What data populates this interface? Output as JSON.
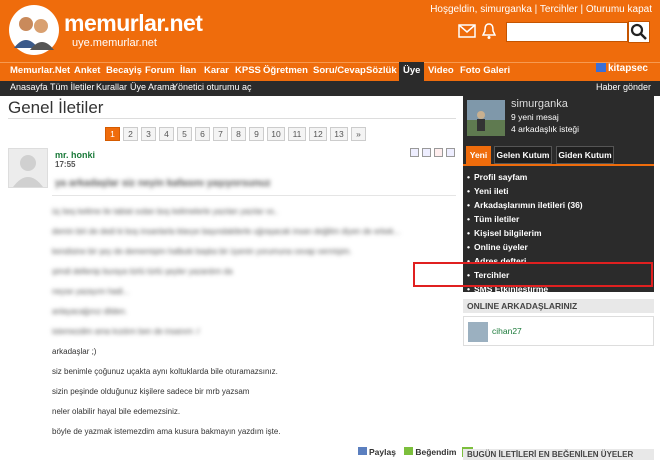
{
  "header": {
    "logo_text": "memurlar.net",
    "logo_sub": "uye.memurlar.net",
    "welcome": "Hoşgeldin, simurganka",
    "preferences_link": "Tercihler",
    "logout_link": "Oturumu kapat",
    "search_placeholder": ""
  },
  "nav": {
    "items": [
      "Memurlar.Net",
      "Anket",
      "Becayiş",
      "Forum",
      "İlan",
      "Karar",
      "KPSS",
      "Öğretmen",
      "Soru/Cevap",
      "Sözlük",
      "Üye",
      "Video",
      "Foto Galeri"
    ],
    "active": "Üye",
    "kitapsec": "kitapsec"
  },
  "subnav": {
    "items": [
      "Anasayfa",
      "Tüm İletiler",
      "Kurallar",
      "Üye Arama",
      "Yönetici oturumu aç"
    ],
    "send_news": "Haber gönder"
  },
  "page": {
    "title": "Genel İletiler",
    "pages": [
      "1",
      "2",
      "3",
      "4",
      "5",
      "6",
      "7",
      "8",
      "9",
      "10",
      "11",
      "12",
      "13",
      "»"
    ],
    "current_page": "1"
  },
  "post": {
    "author": "mr. honki",
    "time": "17:55",
    "headline": "ya arkadaşlar siz neyin kafasını yaşıyorsunuz",
    "lines": [
      "üç beş kelime ile tabiat sıdan boş kelimelerle yazılan yazılar vs..",
      "demin biri de dedi ki boş insanlarla klavye başındakilerle uğraşacak insan değilim diyen de erkek...",
      "kendisine bir şey de dememişim halbuki başka bir üyenin yorumuna cevap vermişim.",
      "şimdi dellenip buraya türlü türlü şeyler yazardım da",
      "neyse yazayım hadi...",
      "anlayacağınız dilden.",
      "istemezdim ama kızdım ben de insanım :/",
      "arkadaşlar ;)",
      "siz benimle çoğunuz uçakta aynı koltuklarda bile oturamazsınız.",
      "sizin peşinde olduğunuz kişilere sadece bir mrb yazsam",
      "neler olabilir hayal bile edemezsiniz.",
      "böyle de yazmak istemezdim ama kusura bakmayın yazdım işte."
    ],
    "share": "Paylaş",
    "like": "Beğendim",
    "like_count": "0"
  },
  "sidebar": {
    "username": "simurganka",
    "messages": "9 yeni mesaj",
    "friend_requests": "4 arkadaşlık isteği",
    "tabs": [
      "Yeni",
      "Gelen Kutum",
      "Giden Kutum"
    ],
    "menu": [
      "Profil sayfam",
      "Yeni ileti",
      "Arkadaşlarımın iletileri (36)",
      "Tüm iletiler",
      "Kişisel bilgilerim",
      "Online üyeler",
      "Adres defteri",
      "Tercihler",
      "SMS Etkinleştirme"
    ],
    "online_title": "ONLINE ARKADAŞLARINIZ",
    "online_friend": "cihan27",
    "today_title": "BUGÜN İLETİLERİ EN BEĞENİLEN ÜYELER"
  },
  "colors": {
    "brand": "#ef6c0c",
    "dark": "#2b2b2b",
    "highlight": "#e02020"
  }
}
